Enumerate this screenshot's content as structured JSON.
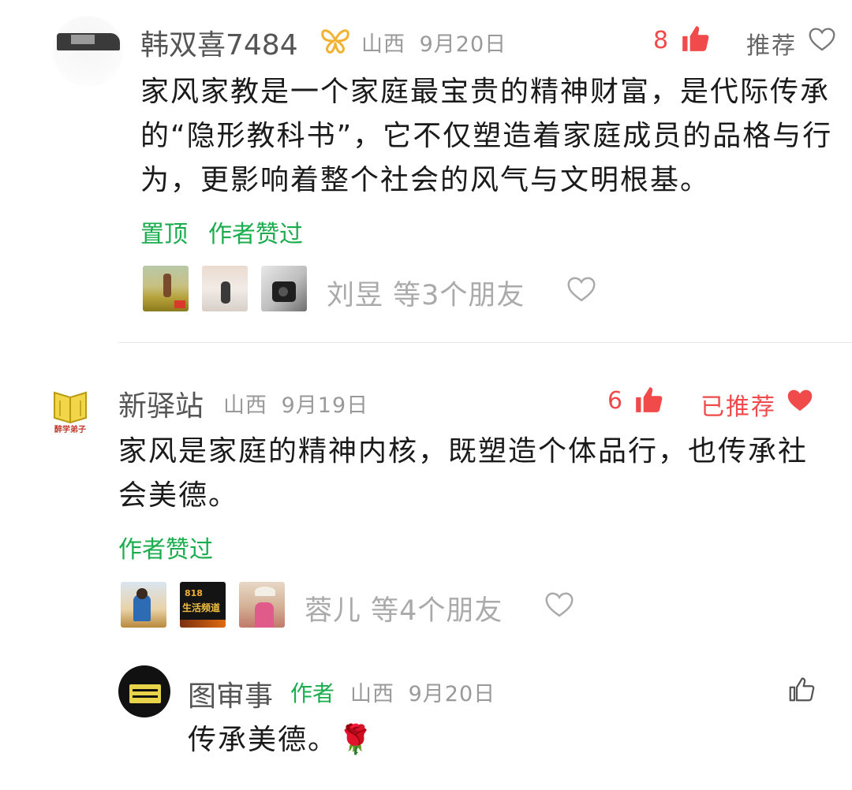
{
  "comments": [
    {
      "user": "韩双喜7484",
      "location": "山西",
      "date": "9月20日",
      "likes": "8",
      "recommend_label": "推荐",
      "text": "家风家教是一个家庭最宝贵的精神财富，是代际传承的“隐形教科书”，它不仅塑造着家庭成员的品格与行为，更影响着整个社会的风气与文明根基。",
      "tags": [
        "置顶",
        "作者赞过"
      ],
      "friends_text": "刘昱 等3个朋友"
    },
    {
      "user": "新驿站",
      "avatar_text": "醉学弟子",
      "location": "山西",
      "date": "9月19日",
      "likes": "6",
      "recommend_label": "已推荐",
      "text": "家风是家庭的精神内核，既塑造个体品行，也传承社会美德。",
      "tags": [
        "作者赞过"
      ],
      "friends_text": "蓉儿 等4个朋友",
      "thumb2_text": "生活频道"
    }
  ],
  "reply": {
    "user": "图审事",
    "author_tag": "作者",
    "location": "山西",
    "date": "9月20日",
    "text": "传承美德。🌹"
  },
  "colors": {
    "accent_green": "#1aad4e",
    "like_red": "#f04a4a"
  }
}
